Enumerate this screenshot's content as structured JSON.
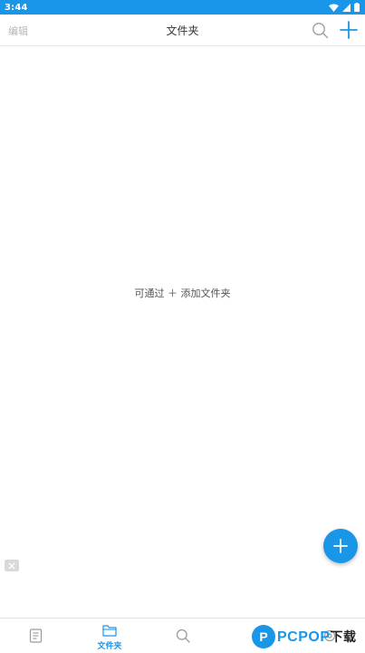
{
  "status_bar": {
    "time": "3:44"
  },
  "header": {
    "edit_label": "编辑",
    "title": "文件夹"
  },
  "main": {
    "empty_hint": "可通过 ＋ 添加文件夹"
  },
  "bottom_nav": {
    "items": [
      {
        "icon": "notes-icon",
        "label": ""
      },
      {
        "icon": "folder-icon",
        "label": "文件夹",
        "active": true
      },
      {
        "icon": "search-icon",
        "label": ""
      },
      {
        "icon": "settings-icon",
        "label": ""
      }
    ]
  },
  "watermark": {
    "text": "PCPOP",
    "suffix": "下载"
  },
  "colors": {
    "accent": "#1a96e8",
    "text": "#333333",
    "muted": "#b6b6b6"
  }
}
